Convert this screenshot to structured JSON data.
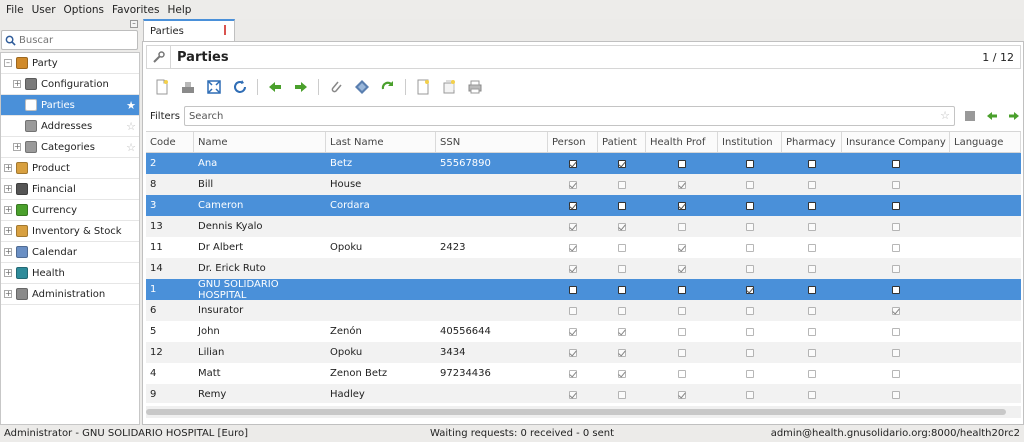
{
  "menubar": [
    "File",
    "User",
    "Options",
    "Favorites",
    "Help"
  ],
  "sidebar": {
    "search_placeholder": "Buscar",
    "collapse": "–",
    "tree": [
      {
        "label": "Party",
        "level": 0,
        "expander": "–",
        "color": "#d08a2a"
      },
      {
        "label": "Configuration",
        "level": 1,
        "expander": "+",
        "color": "#7a7a7a"
      },
      {
        "label": "Parties",
        "level": 1,
        "expander": "",
        "color": "#ffffff",
        "selected": true,
        "star": "★"
      },
      {
        "label": "Addresses",
        "level": 1,
        "expander": "",
        "color": "#9a9a9a",
        "star": "☆"
      },
      {
        "label": "Categories",
        "level": 1,
        "expander": "+",
        "color": "#9a9a9a",
        "star": "☆"
      },
      {
        "label": "Product",
        "level": 0,
        "expander": "+",
        "color": "#d8a040"
      },
      {
        "label": "Financial",
        "level": 0,
        "expander": "+",
        "color": "#555555"
      },
      {
        "label": "Currency",
        "level": 0,
        "expander": "+",
        "color": "#4aa02c"
      },
      {
        "label": "Inventory & Stock",
        "level": 0,
        "expander": "+",
        "color": "#d8a040"
      },
      {
        "label": "Calendar",
        "level": 0,
        "expander": "+",
        "color": "#6a8fc4"
      },
      {
        "label": "Health",
        "level": 0,
        "expander": "+",
        "color": "#2e8b9a"
      },
      {
        "label": "Administration",
        "level": 0,
        "expander": "+",
        "color": "#8a8a8a"
      }
    ]
  },
  "tab": {
    "label": "Parties"
  },
  "panel": {
    "title": "Parties",
    "pager": "1 / 12"
  },
  "filters": {
    "label": "Filters",
    "placeholder": "Search"
  },
  "table": {
    "columns": [
      "Code",
      "Name",
      "Last Name",
      "SSN",
      "Person",
      "Patient",
      "Health Prof",
      "Institution",
      "Pharmacy",
      "Insurance Company",
      "Language"
    ],
    "rows": [
      {
        "code": "2",
        "name": "Ana",
        "last": "Betz",
        "ssn": "55567890",
        "flags": [
          true,
          true,
          false,
          false,
          false,
          false
        ],
        "sel": true
      },
      {
        "code": "8",
        "name": "Bill",
        "last": "House",
        "ssn": "",
        "flags": [
          true,
          false,
          true,
          false,
          false,
          false
        ]
      },
      {
        "code": "3",
        "name": "Cameron",
        "last": "Cordara",
        "ssn": "",
        "flags": [
          true,
          false,
          true,
          false,
          false,
          false
        ],
        "sel": true
      },
      {
        "code": "13",
        "name": "Dennis Kyalo",
        "last": "",
        "ssn": "",
        "flags": [
          true,
          true,
          false,
          false,
          false,
          false
        ]
      },
      {
        "code": "11",
        "name": "Dr Albert",
        "last": "Opoku",
        "ssn": "2423",
        "flags": [
          true,
          false,
          true,
          false,
          false,
          false
        ]
      },
      {
        "code": "14",
        "name": "Dr. Erick Ruto",
        "last": "",
        "ssn": "",
        "flags": [
          true,
          false,
          true,
          false,
          false,
          false
        ]
      },
      {
        "code": "1",
        "name": "GNU SOLIDARIO HOSPITAL",
        "last": "",
        "ssn": "",
        "flags": [
          false,
          false,
          false,
          true,
          false,
          false
        ],
        "sel": true
      },
      {
        "code": "6",
        "name": "Insurator",
        "last": "",
        "ssn": "",
        "flags": [
          false,
          false,
          false,
          false,
          false,
          true
        ]
      },
      {
        "code": "5",
        "name": "John",
        "last": "Zenón",
        "ssn": "40556644",
        "flags": [
          true,
          true,
          false,
          false,
          false,
          false
        ]
      },
      {
        "code": "12",
        "name": "Lilian",
        "last": "Opoku",
        "ssn": "3434",
        "flags": [
          true,
          true,
          false,
          false,
          false,
          false
        ]
      },
      {
        "code": "4",
        "name": "Matt",
        "last": "Zenon Betz",
        "ssn": "97234436",
        "flags": [
          true,
          true,
          false,
          false,
          false,
          false
        ]
      },
      {
        "code": "9",
        "name": "Remy",
        "last": "Hadley",
        "ssn": "",
        "flags": [
          true,
          false,
          true,
          false,
          false,
          false
        ]
      }
    ]
  },
  "status": {
    "left": "Administrator - GNU SOLIDARIO HOSPITAL [Euro]",
    "center": "Waiting requests: 0 received - 0 sent",
    "right": "admin@health.gnusolidario.org:8000/health20rc2"
  },
  "colors": {
    "selection": "#4a90d9",
    "accent": "#4a90d9"
  }
}
